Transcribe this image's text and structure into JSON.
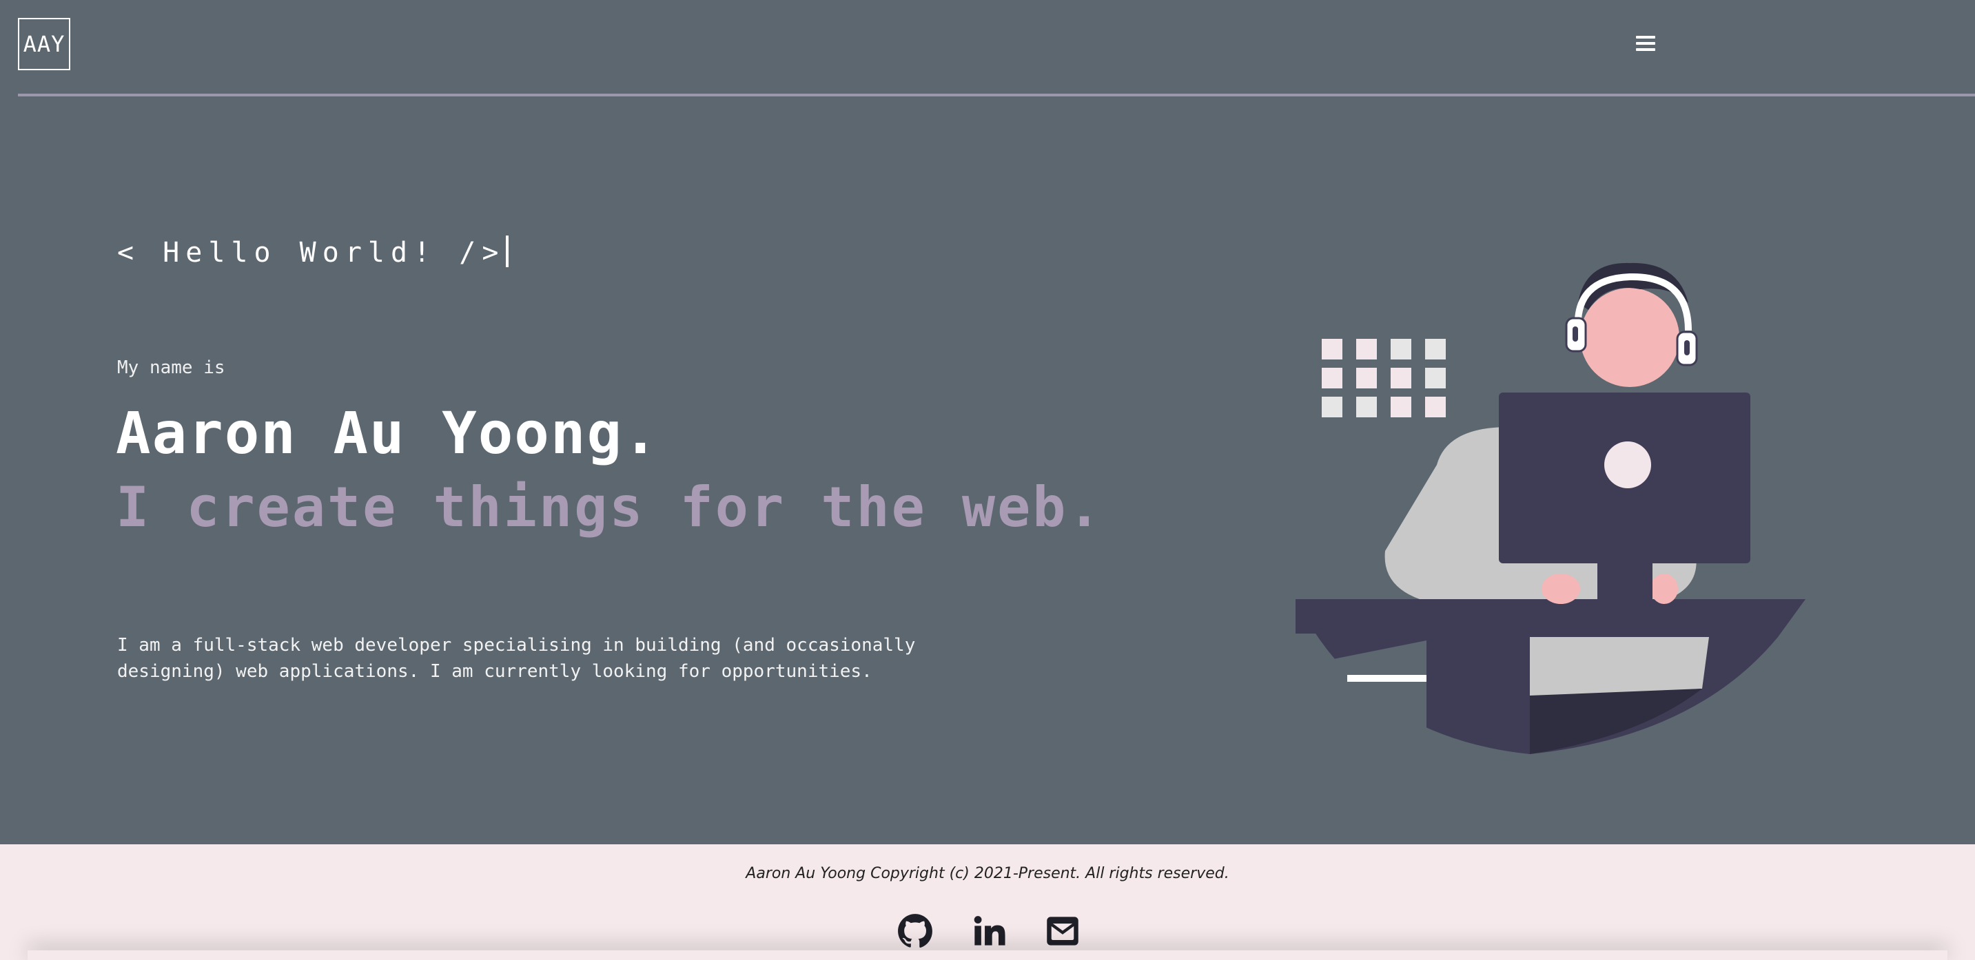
{
  "header": {
    "logo_text": "AAY",
    "menu_icon": "hamburger-menu-icon"
  },
  "hero": {
    "greeting": "< Hello World! />",
    "intro": "My name is",
    "name": "Aaron Au Yoong.",
    "tagline": "I create things for the web.",
    "bio": "I am a full-stack web developer specialising in building (and occasionally designing) web applications. I am currently looking for opportunities."
  },
  "illustration": {
    "subject": "developer-at-laptop-illustration"
  },
  "footer": {
    "copyright": "Aaron Au Yoong Copyright (c) 2021-Present. All rights reserved.",
    "socials": [
      {
        "icon": "github-icon"
      },
      {
        "icon": "linkedin-icon"
      },
      {
        "icon": "email-icon"
      }
    ]
  },
  "colors": {
    "background": "#5c6770",
    "accent": "#a89bb3",
    "footer_background": "#f5e9eb",
    "text": "#ffffff"
  }
}
